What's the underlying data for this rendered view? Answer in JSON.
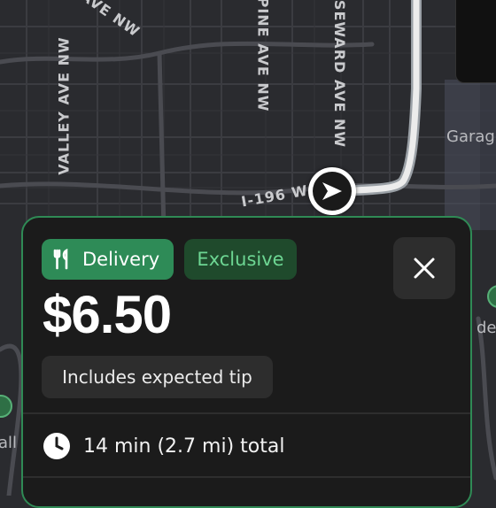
{
  "map": {
    "streets": {
      "avenue_nw_fragment": "AVE NW",
      "valley": "VALLEY AVE NW",
      "pine": "PINE AVE NW",
      "seward": "SEWARD AVE NW",
      "highway": "I-196 W"
    },
    "places": {
      "garage_fragment": "Garag",
      "right_edge_fragment": "de",
      "left_edge_fragment": "all"
    },
    "colors": {
      "background": "#2a2b2f",
      "route": "#e9e9e9"
    }
  },
  "offer": {
    "badges": {
      "delivery": "Delivery",
      "exclusive": "Exclusive"
    },
    "price": "$6.50",
    "tip_note": "Includes expected tip",
    "trip_summary": "14 min (2.7 mi) total",
    "colors": {
      "accent": "#2e8b57",
      "exclusive_text": "#6dd693",
      "card": "#1b1b1b"
    },
    "icons": {
      "delivery": "fork-knife-icon",
      "close": "close-icon",
      "clock": "clock-icon",
      "navigation": "navigation-arrow-icon"
    }
  }
}
